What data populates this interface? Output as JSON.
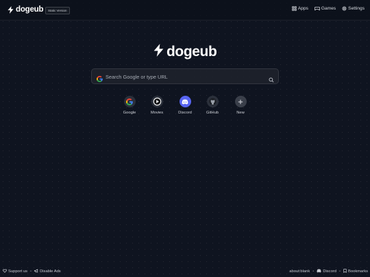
{
  "brand": {
    "name": "dogeub",
    "badge": "Static Version"
  },
  "nav": [
    {
      "label": "Apps",
      "icon": "grid-icon"
    },
    {
      "label": "Games",
      "icon": "gamepad-icon"
    },
    {
      "label": "Settings",
      "icon": "gear-icon"
    }
  ],
  "logo": {
    "name": "dogeub"
  },
  "search": {
    "placeholder": "Search Google or type URL",
    "value": ""
  },
  "shortcuts": [
    {
      "label": "Google",
      "icon": "google-icon"
    },
    {
      "label": "Movies",
      "icon": "play-icon"
    },
    {
      "label": "Discord",
      "icon": "discord-icon"
    },
    {
      "label": "GitHub",
      "icon": "github-icon"
    },
    {
      "label": "New",
      "icon": "plus-icon"
    }
  ],
  "footer": {
    "left": [
      {
        "label": "Support us",
        "icon": "heart-icon"
      },
      {
        "label": "Disable Ads",
        "icon": "megaphone-icon"
      }
    ],
    "right": [
      {
        "label": "about:blank"
      },
      {
        "label": "Discord",
        "icon": "discord-icon"
      },
      {
        "label": "Bookmarks",
        "icon": "bookmark-icon"
      }
    ]
  },
  "colors": {
    "background": "#0f1420",
    "accent_discord": "#5865f2",
    "text": "#e6e8ec"
  }
}
